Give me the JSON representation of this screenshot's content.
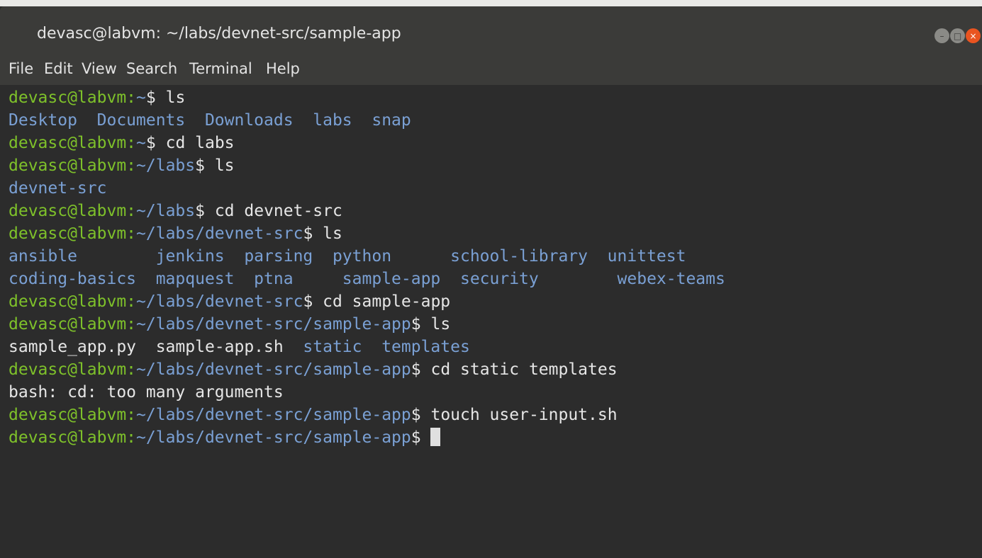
{
  "window": {
    "title": "devasc@labvm: ~/labs/devnet-src/sample-app"
  },
  "menu": {
    "items": [
      "File",
      "Edit",
      "View",
      "Search",
      "Terminal",
      "Help"
    ]
  },
  "prompt": {
    "user_host": "devasc@labvm",
    "colon": ":"
  },
  "terminal": {
    "lines": [
      {
        "path": "~",
        "command": " ls"
      },
      {
        "output_dirs": "Desktop  Documents  Downloads  labs  snap"
      },
      {
        "path": "~",
        "command": " cd labs"
      },
      {
        "path": "~/labs",
        "command": " ls"
      },
      {
        "output_dirs": "devnet-src"
      },
      {
        "path": "~/labs",
        "command": " cd devnet-src"
      },
      {
        "path": "~/labs/devnet-src",
        "command": " ls"
      },
      {
        "output_dirs": "ansible        jenkins  parsing  python      school-library  unittest"
      },
      {
        "output_dirs": "coding-basics  mapquest  ptna     sample-app  security        webex-teams"
      },
      {
        "path": "~/labs/devnet-src",
        "command": " cd sample-app"
      },
      {
        "path": "~/labs/devnet-src/sample-app",
        "command": " ls"
      },
      {
        "output_files": "sample_app.py  sample-app.sh  ",
        "output_dirs": "static  templates"
      },
      {
        "path": "~/labs/devnet-src/sample-app",
        "command": " cd static templates"
      },
      {
        "output_text": "bash: cd: too many arguments"
      },
      {
        "path": "~/labs/devnet-src/sample-app",
        "command": " touch user-input.sh"
      },
      {
        "path": "~/labs/devnet-src/sample-app",
        "command": " "
      }
    ]
  },
  "colors": {
    "user": "#7ec12a",
    "path": "#7aa0d4",
    "text": "#e6e6e6",
    "background": "#2c2c2c",
    "titlebar": "#3b3b39",
    "close_button": "#e95420"
  },
  "icons": {
    "minimize": "minimize-icon",
    "maximize": "maximize-icon",
    "close": "close-icon"
  }
}
